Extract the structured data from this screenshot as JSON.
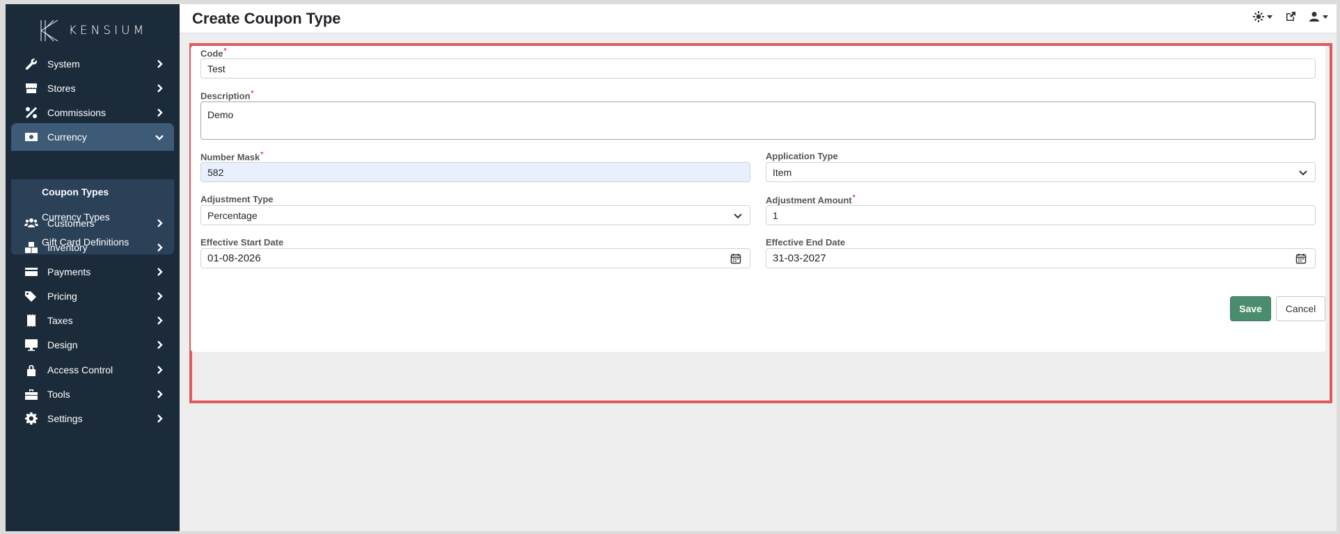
{
  "app": {
    "logo_text": "KENSIUM"
  },
  "sidebar": {
    "items": [
      {
        "label": "System",
        "icon": "wrench-icon"
      },
      {
        "label": "Stores",
        "icon": "store-icon"
      },
      {
        "label": "Commissions",
        "icon": "percent-icon"
      },
      {
        "label": "Currency",
        "icon": "money-icon",
        "active": true
      },
      {
        "label": "Customers",
        "icon": "users-icon"
      },
      {
        "label": "Inventory",
        "icon": "boxes-icon"
      },
      {
        "label": "Payments",
        "icon": "credit-card-icon"
      },
      {
        "label": "Pricing",
        "icon": "tags-icon"
      },
      {
        "label": "Taxes",
        "icon": "receipt-icon"
      },
      {
        "label": "Design",
        "icon": "monitor-icon"
      },
      {
        "label": "Access Control",
        "icon": "lock-icon"
      },
      {
        "label": "Tools",
        "icon": "toolbox-icon"
      },
      {
        "label": "Settings",
        "icon": "gear-icon"
      }
    ],
    "submenu": [
      {
        "label": "Coupon Types",
        "current": true
      },
      {
        "label": "Currency Types"
      },
      {
        "label": "Gift Card Definitions"
      }
    ]
  },
  "header": {
    "title": "Create Coupon Type"
  },
  "form": {
    "code": {
      "label": "Code",
      "value": "Test"
    },
    "description": {
      "label": "Description",
      "value": "Demo"
    },
    "number_mask": {
      "label": "Number Mask",
      "value": "582"
    },
    "application_type": {
      "label": "Application Type",
      "value": "Item"
    },
    "adjustment_type": {
      "label": "Adjustment Type",
      "value": "Percentage"
    },
    "adjustment_amount": {
      "label": "Adjustment Amount",
      "value": "1"
    },
    "effective_start_date": {
      "label": "Effective Start Date",
      "value": "01-08-2026"
    },
    "effective_end_date": {
      "label": "Effective End Date",
      "value": "31-03-2027"
    },
    "required_mark": "*"
  },
  "actions": {
    "save_label": "Save",
    "cancel_label": "Cancel"
  },
  "colors": {
    "sidebar": "#1c2b3a",
    "active": "#3d5a76",
    "save": "#4a8c6e",
    "highlight": "#e05a5f"
  }
}
